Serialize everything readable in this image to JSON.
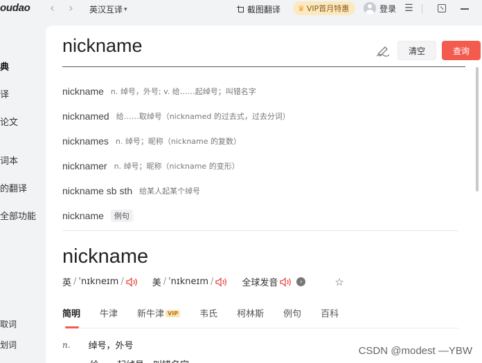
{
  "titlebar": {
    "logo": "oudao",
    "back_glyph": "‹",
    "forward_glyph": "›",
    "mode": "英汉互译",
    "screenshot_translate": "截图翻译",
    "vip_promo": "VIP首月特惠",
    "login": "登录",
    "menu_glyph": "☰"
  },
  "sidebar": {
    "items": [
      "典",
      "译",
      "论文",
      "词本",
      "的翻译",
      "全部功能"
    ],
    "bottom_items": [
      "取词",
      "划词"
    ]
  },
  "search": {
    "query": "nickname",
    "clear_label": "清空",
    "search_label": "查询"
  },
  "suggestions": [
    {
      "word": "nickname",
      "definition": "n. 绰号，外号; v. 给……起绰号；叫错名字"
    },
    {
      "word": "nicknamed",
      "definition": "给……取绰号（nicknamed 的过去式，过去分词）"
    },
    {
      "word": "nicknames",
      "definition": "n. 绰号；昵称（nickname 的复数）"
    },
    {
      "word": "nicknamer",
      "definition": "n. 绰号；昵称（nickname 的变形）"
    },
    {
      "word": "nickname sb sth",
      "definition": "给某人起某个绰号"
    },
    {
      "word": "nickname",
      "tag": "例句"
    }
  ],
  "entry": {
    "word": "nickname",
    "uk_label": "英",
    "uk_ipa": "ˈnɪkneɪm",
    "us_label": "美",
    "us_ipa": "ˈnɪkneɪm",
    "global_label": "全球发音",
    "slash": "/"
  },
  "tabs": [
    {
      "label": "简明",
      "active": true
    },
    {
      "label": "牛津"
    },
    {
      "label": "新牛津",
      "badge": "VIP"
    },
    {
      "label": "韦氏"
    },
    {
      "label": "柯林斯"
    },
    {
      "label": "例句"
    },
    {
      "label": "百科"
    }
  ],
  "definitions": {
    "pos": "n.",
    "def1": "绰号，外号",
    "def2_partial": "给……起绰号，叫错名字"
  },
  "watermark": "CSDN @modest —YBW",
  "colors": {
    "accent": "#f45b4f",
    "vip_bg": "#fce9c2",
    "background": "#f2f3f5"
  }
}
